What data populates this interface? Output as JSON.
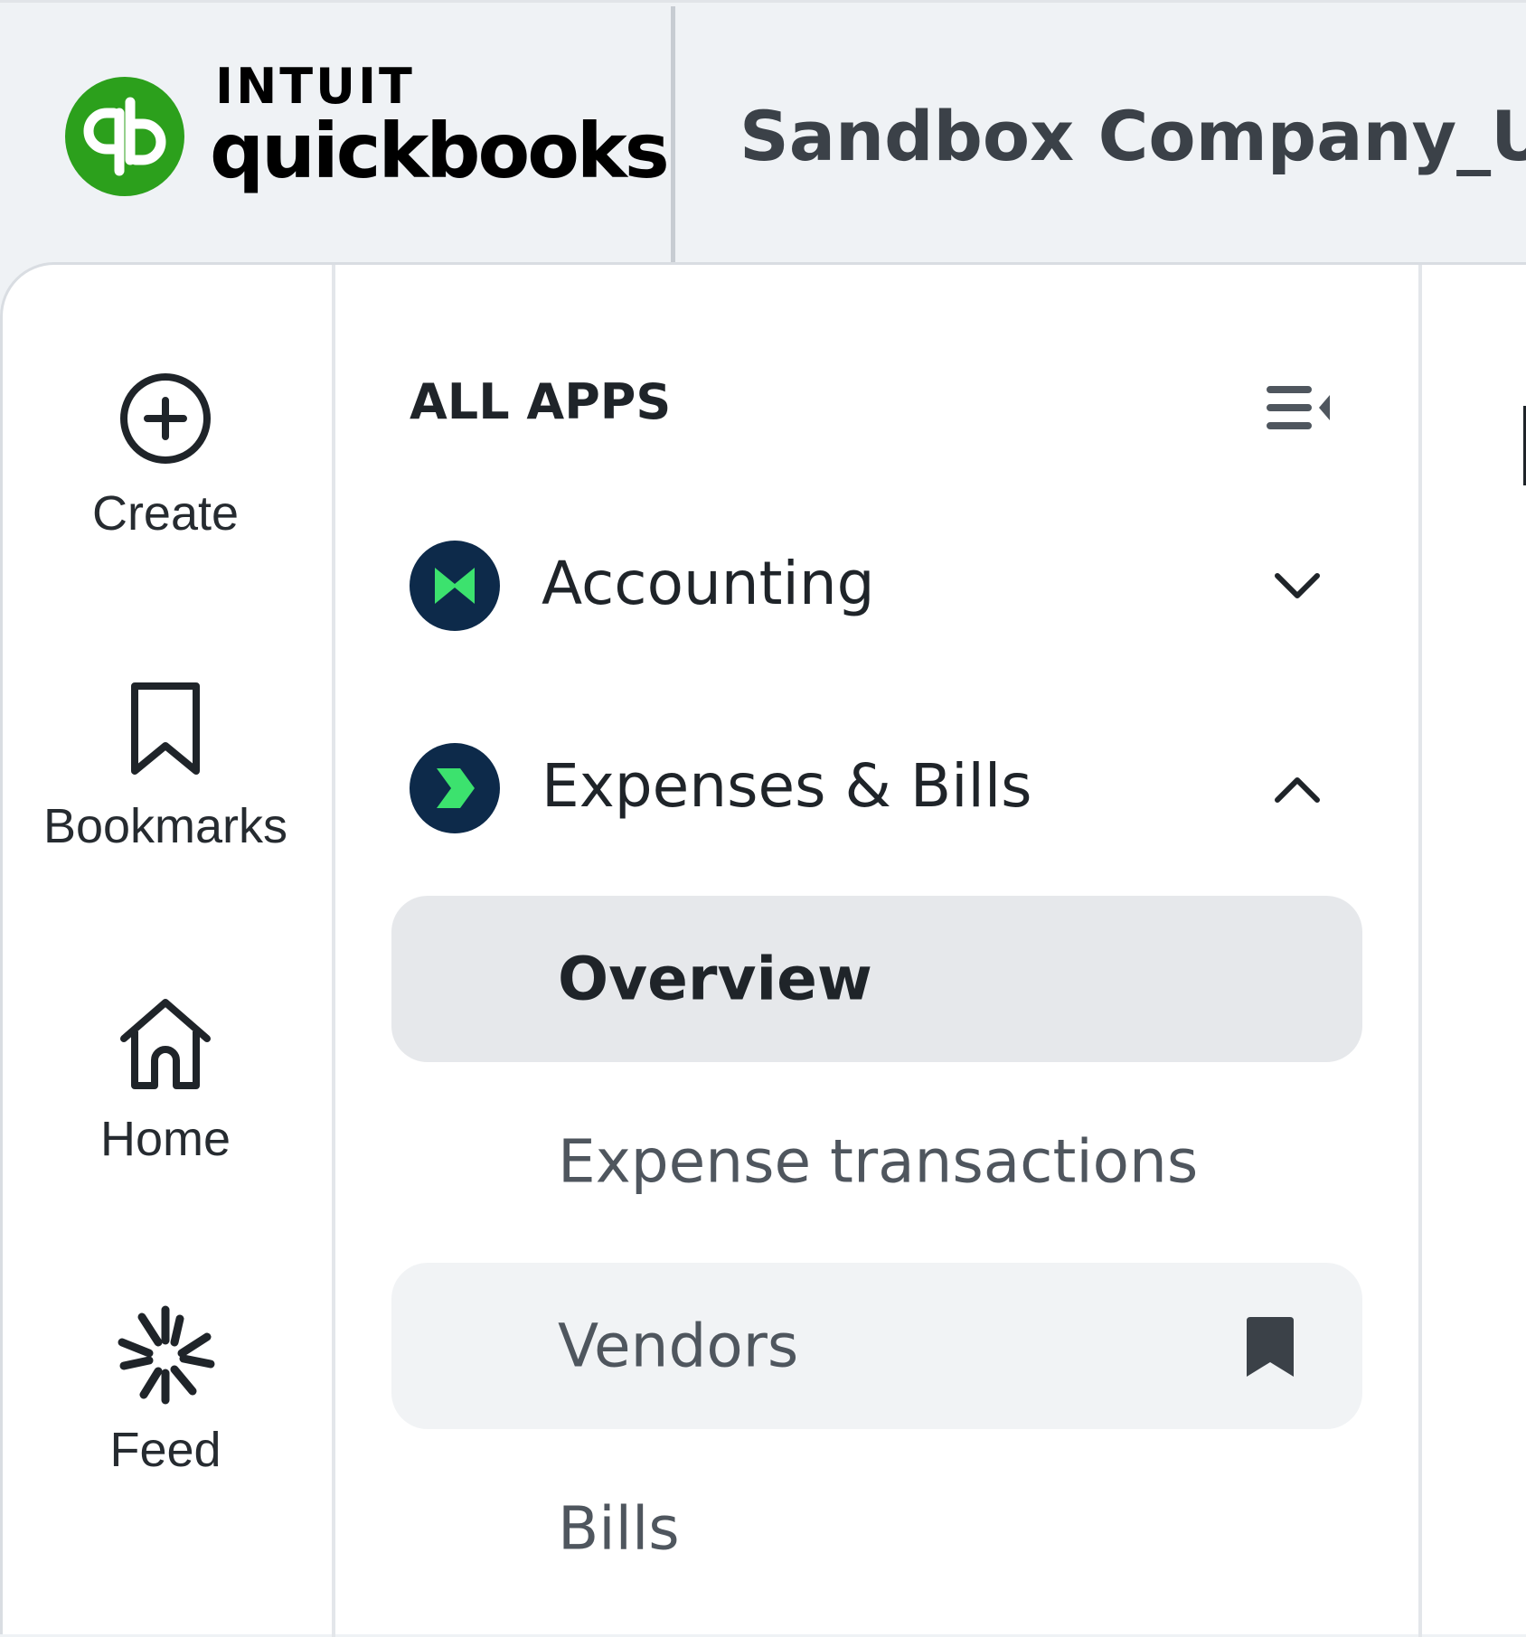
{
  "header": {
    "brand_top": "INTUIT",
    "brand_bottom": "quickbooks",
    "company_name": "Sandbox Company_US"
  },
  "rail": {
    "items": [
      {
        "label": "Create",
        "icon": "plus-circle-icon"
      },
      {
        "label": "Bookmarks",
        "icon": "bookmark-icon"
      },
      {
        "label": "Home",
        "icon": "home-icon"
      },
      {
        "label": "Feed",
        "icon": "sparkle-icon"
      }
    ]
  },
  "menu": {
    "heading": "ALL APPS",
    "apps": [
      {
        "label": "Accounting",
        "expanded": false,
        "icon": "accounting-app-icon"
      },
      {
        "label": "Expenses & Bills",
        "expanded": true,
        "icon": "expenses-app-icon"
      }
    ],
    "sub_items": [
      {
        "label": "Overview",
        "active": true
      },
      {
        "label": "Expense transactions",
        "active": false
      },
      {
        "label": "Vendors",
        "active": false,
        "bookmarked": true
      },
      {
        "label": "Bills",
        "active": false
      }
    ]
  },
  "colors": {
    "brand_green": "#2ca01c",
    "app_icon_bg": "#0d2a4a",
    "app_icon_accent": "#3ce26e",
    "header_bg": "#eff2f5"
  }
}
